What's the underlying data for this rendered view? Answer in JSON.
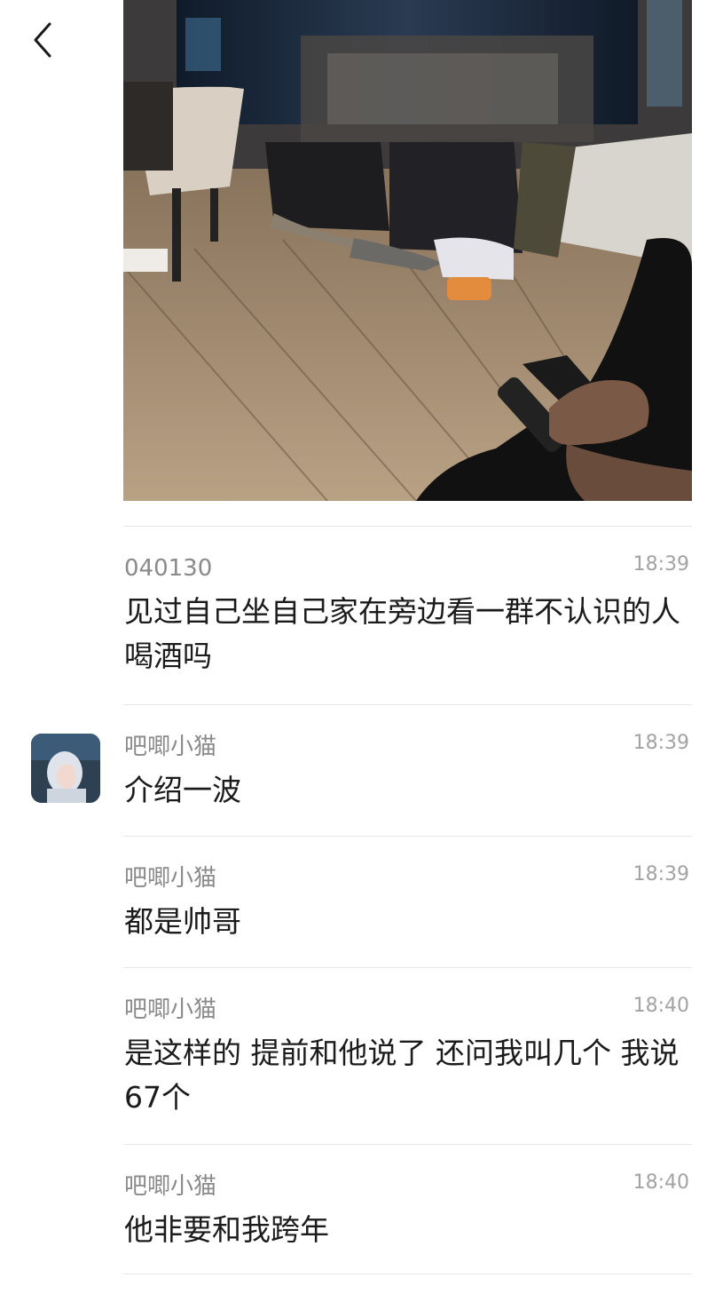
{
  "nav": {
    "back_icon": "chevron-left-icon"
  },
  "photo": {
    "description_icon": "shared-photo"
  },
  "comments": [
    {
      "author": "040130",
      "time": "18:39",
      "text": "见过自己坐自己家在旁边看一群不认识的人喝酒吗",
      "has_avatar": false
    },
    {
      "author": "吧唧小猫",
      "time": "18:39",
      "text": "介绍一波",
      "has_avatar": true
    },
    {
      "author": "吧唧小猫",
      "time": "18:39",
      "text": "都是帅哥",
      "has_avatar": false
    },
    {
      "author": "吧唧小猫",
      "time": "18:40",
      "text": "是这样的 提前和他说了 还问我叫几个 我说67个",
      "has_avatar": false
    },
    {
      "author": "吧唧小猫",
      "time": "18:40",
      "text": "他非要和我跨年",
      "has_avatar": false
    }
  ],
  "colors": {
    "author": "#8a8a8a",
    "time": "#a3a3a3",
    "text": "#1b1b1b",
    "divider": "#e7e7e7"
  }
}
